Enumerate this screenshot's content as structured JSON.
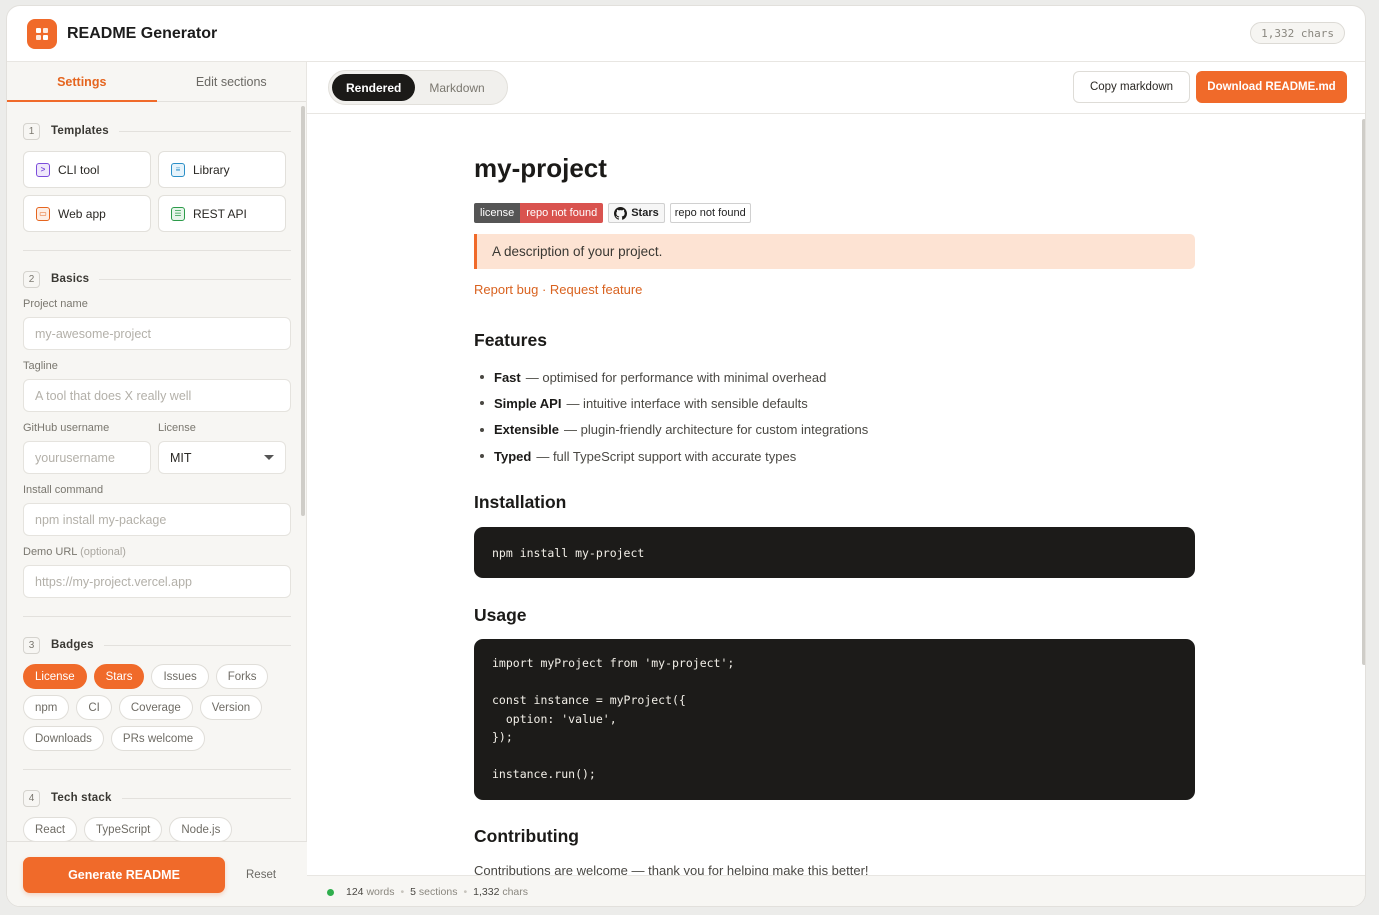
{
  "app": {
    "title": "README Generator",
    "chars_pill": "1,332 chars"
  },
  "sidebar": {
    "tabs": [
      {
        "label": "Settings"
      },
      {
        "label": "Edit sections"
      }
    ],
    "templates": {
      "num": "1",
      "title": "Templates",
      "items": [
        {
          "label": "CLI tool",
          "icon": "terminal-icon",
          "color": "#7c4ddb"
        },
        {
          "label": "Library",
          "icon": "book-icon",
          "color": "#2b8fc7"
        },
        {
          "label": "Web app",
          "icon": "browser-icon",
          "color": "#e5651f"
        },
        {
          "label": "REST API",
          "icon": "server-icon",
          "color": "#2c9b4a"
        }
      ]
    },
    "basics": {
      "num": "2",
      "title": "Basics",
      "project_name": {
        "label": "Project name",
        "placeholder": "my-awesome-project"
      },
      "tagline": {
        "label": "Tagline",
        "placeholder": "A tool that does X really well"
      },
      "github": {
        "label": "GitHub username",
        "placeholder": "yourusername"
      },
      "license": {
        "label": "License",
        "value": "MIT"
      },
      "install": {
        "label": "Install command",
        "placeholder": "npm install my-package"
      },
      "demo": {
        "label": "Demo URL",
        "label_opt": "(optional)",
        "placeholder": "https://my-project.vercel.app"
      }
    },
    "badges": {
      "num": "3",
      "title": "Badges",
      "items": [
        {
          "label": "License",
          "on": true
        },
        {
          "label": "Stars",
          "on": true
        },
        {
          "label": "Issues",
          "on": false
        },
        {
          "label": "Forks",
          "on": false
        },
        {
          "label": "npm",
          "on": false
        },
        {
          "label": "CI",
          "on": false
        },
        {
          "label": "Coverage",
          "on": false
        },
        {
          "label": "Version",
          "on": false
        },
        {
          "label": "Downloads",
          "on": false
        },
        {
          "label": "PRs welcome",
          "on": false
        }
      ]
    },
    "tech": {
      "num": "4",
      "title": "Tech stack",
      "items": [
        {
          "label": "React"
        },
        {
          "label": "TypeScript"
        },
        {
          "label": "Node.js"
        }
      ]
    },
    "footer": {
      "generate": "Generate README",
      "reset": "Reset"
    }
  },
  "toolbar": {
    "tabs": [
      {
        "label": "Rendered",
        "active": true
      },
      {
        "label": "Markdown",
        "active": false
      }
    ],
    "copy": "Copy markdown",
    "download": "Download README.md"
  },
  "doc": {
    "title": "my-project",
    "badges": {
      "license_l": "license",
      "license_r": "repo not found",
      "stars": "Stars",
      "notfound": "repo not found"
    },
    "description": "A description of your project.",
    "links": {
      "bug": "Report bug",
      "sep": " · ",
      "feature": "Request feature"
    },
    "features_h": "Features",
    "features": [
      {
        "name": "Fast",
        "text": "— optimised for performance with minimal overhead"
      },
      {
        "name": "Simple API",
        "text": "— intuitive interface with sensible defaults"
      },
      {
        "name": "Extensible",
        "text": "— plugin-friendly architecture for custom integrations"
      },
      {
        "name": "Typed",
        "text": "— full TypeScript support with accurate types"
      }
    ],
    "install_h": "Installation",
    "install_code": "npm install my-project",
    "usage_h": "Usage",
    "usage_code": [
      "import myProject from 'my-project';",
      "",
      "const instance = myProject({",
      "  option: 'value',",
      "});",
      "",
      "instance.run();"
    ],
    "contrib_h": "Contributing",
    "contrib_p": "Contributions are welcome — thank you for helping make this better!"
  },
  "status": {
    "words": "124",
    "words_l": "words",
    "sections": "5",
    "sections_l": "sections",
    "chars": "1,332",
    "chars_l": "chars",
    "sep": "•"
  },
  "colors": {
    "accent": "#f06a2a",
    "ok": "#2fae4d"
  }
}
